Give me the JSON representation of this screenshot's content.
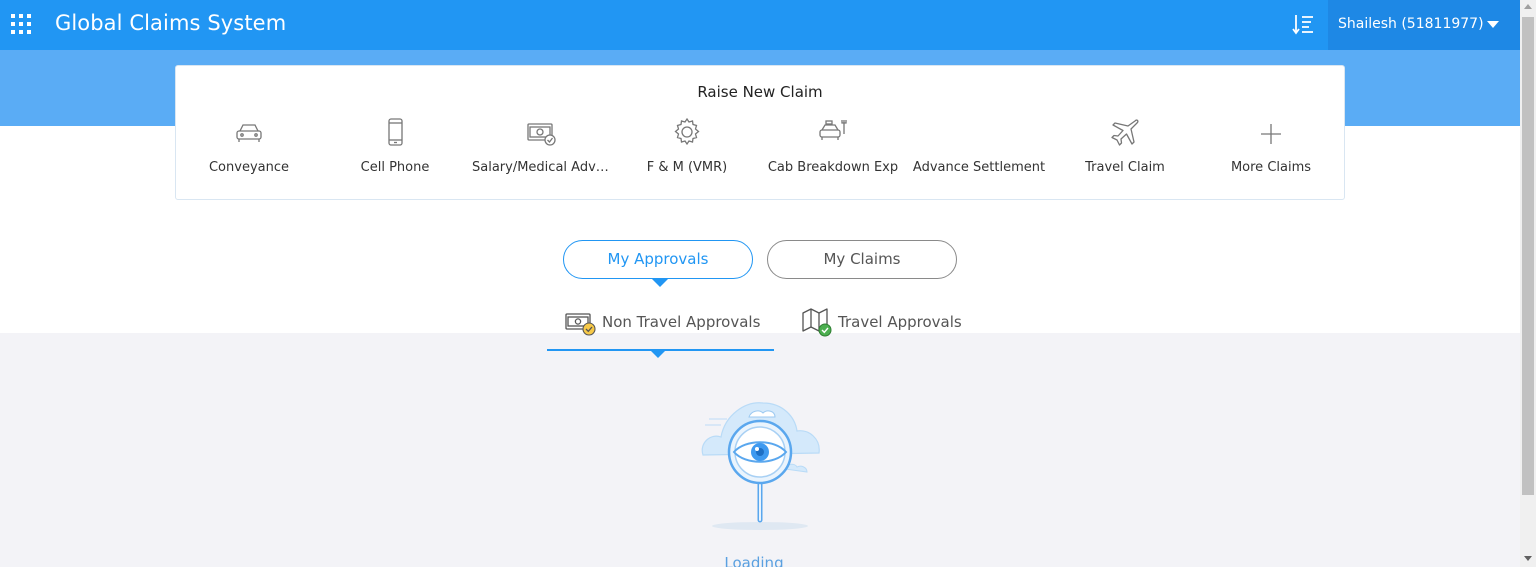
{
  "header": {
    "app_title": "Global Claims System",
    "user_label": "Shailesh (51811977)",
    "icons": {
      "apps": "apps-grid-icon",
      "sort": "sort-list-icon",
      "caret": "caret-down-icon"
    }
  },
  "raise_claim": {
    "title": "Raise New Claim",
    "items": [
      {
        "label": "Conveyance",
        "icon": "car-icon"
      },
      {
        "label": "Cell Phone",
        "icon": "phone-icon"
      },
      {
        "label": "Salary/Medical Advance",
        "icon": "money-icon"
      },
      {
        "label": "F & M (VMR)",
        "icon": "gear-icon"
      },
      {
        "label": "Cab Breakdown Exp",
        "icon": "cab-breakdown-icon"
      },
      {
        "label": "Advance Settlement",
        "icon": "advance-settlement-icon"
      },
      {
        "label": "Travel Claim",
        "icon": "airplane-icon"
      },
      {
        "label": "More Claims",
        "icon": "plus-icon"
      }
    ]
  },
  "toggle": {
    "my_approvals": "My Approvals",
    "my_claims": "My Claims",
    "selected": "My Approvals"
  },
  "subtabs": {
    "non_travel": "Non Travel Approvals",
    "travel": "Travel Approvals",
    "selected": "Non Travel Approvals"
  },
  "status": {
    "loading_text": "Loading"
  },
  "colors": {
    "primary": "#2196f3",
    "header_user_bg": "#1e88e5",
    "band": "#5aacf5",
    "content_bg": "#f3f3f7"
  }
}
